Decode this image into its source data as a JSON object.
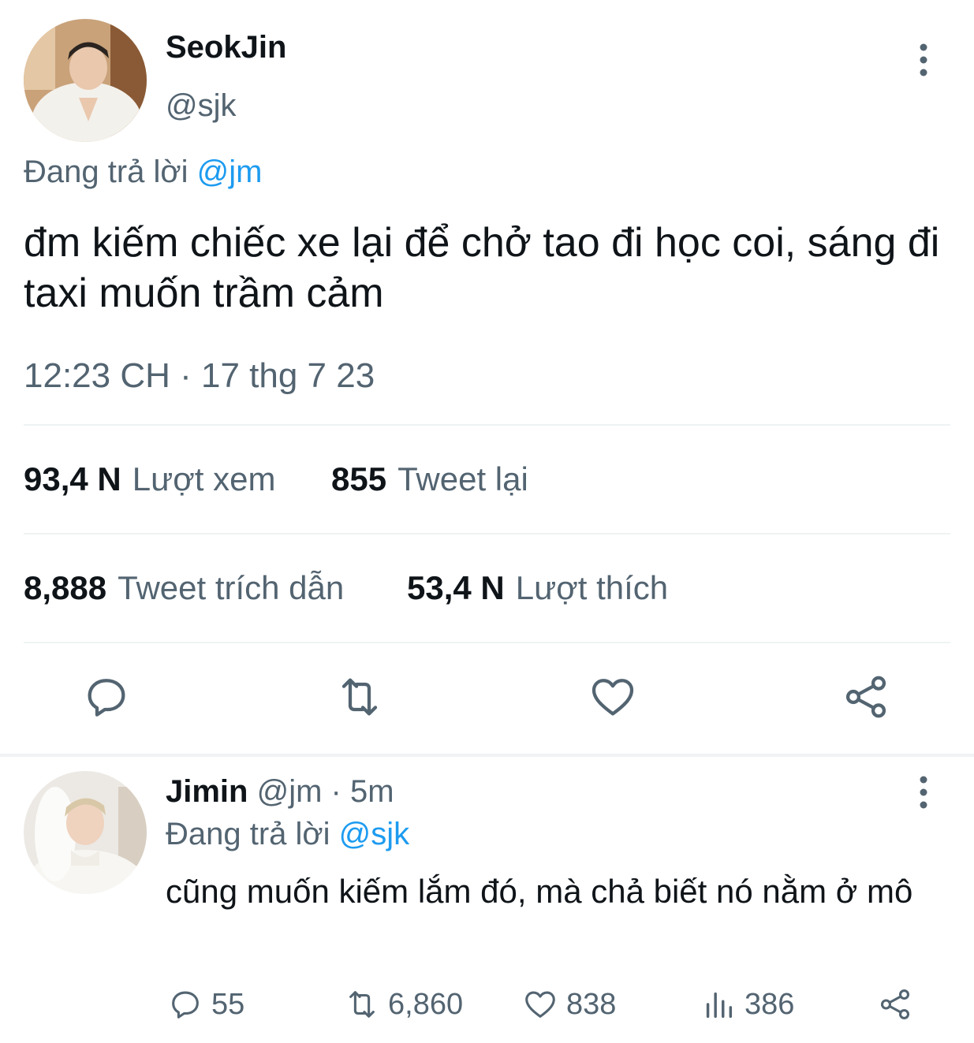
{
  "main_tweet": {
    "author_name": "SeokJin",
    "author_handle": "@sjk",
    "replying_to_prefix": "Đang trả lời",
    "replying_to_handle": "@jm",
    "text": "đm kiếm chiếc xe lại để chở tao đi học coi, sáng đi taxi muốn trầm cảm",
    "timestamp": "12:23 CH · 17 thg 7 23",
    "stats": {
      "views_value": "93,4 N",
      "views_label": "Lượt xem",
      "retweets_value": "855",
      "retweets_label": "Tweet lại",
      "quotes_value": "8,888",
      "quotes_label": "Tweet trích dẫn",
      "likes_value": "53,4 N",
      "likes_label": "Lượt thích"
    },
    "actions": [
      "reply-icon",
      "retweet-icon",
      "like-icon",
      "share-icon"
    ]
  },
  "reply_tweet": {
    "author_name": "Jimin",
    "author_handle": "@jm",
    "separator": "·",
    "time_ago": "5m",
    "replying_to_prefix": "Đang trả lời",
    "replying_to_handle": "@sjk",
    "text": "cũng muốn kiếm lắm đó, mà chả biết nó nằm ở mô",
    "actions": {
      "replies": "55",
      "retweets": "6,860",
      "likes": "838",
      "views": "386"
    }
  },
  "colors": {
    "text_primary": "#0f1419",
    "text_secondary": "#536471",
    "link": "#1d9bf0",
    "divider": "#eff3f4"
  }
}
